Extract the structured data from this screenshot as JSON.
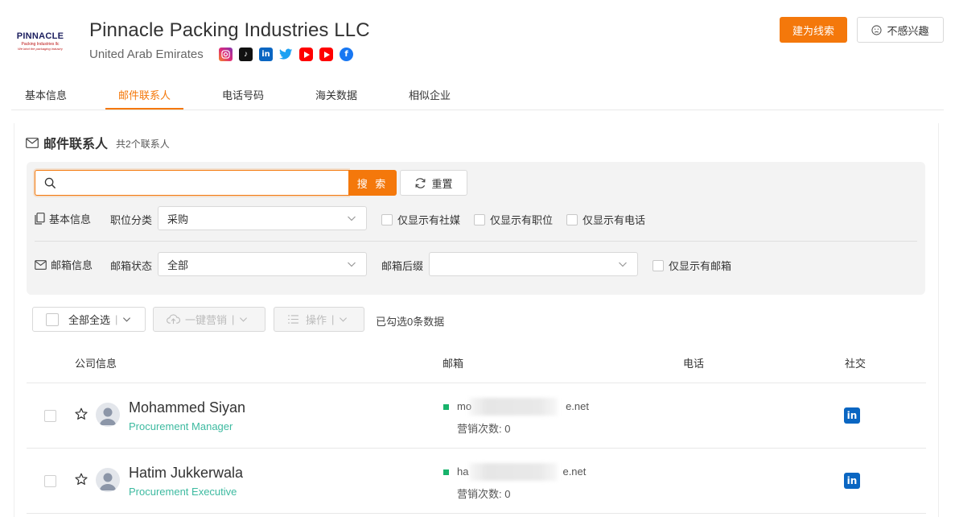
{
  "company": {
    "logo_text": "PINNACLE",
    "logo_sub": "Packing Industries llc",
    "logo_tagline": "We bind the packaging industry",
    "name": "Pinnacle Packing Industries LLC",
    "country": "United Arab Emirates",
    "socials": [
      {
        "icon": "instagram-icon",
        "color": "#e1306c"
      },
      {
        "icon": "tiktok-icon",
        "color": "#111111"
      },
      {
        "icon": "linkedin-icon",
        "color": "#0a66c2"
      },
      {
        "icon": "twitter-icon",
        "color": "#1da1f2"
      },
      {
        "icon": "youtube-icon",
        "color": "#ff0000"
      },
      {
        "icon": "youtube-icon",
        "color": "#ff0000"
      },
      {
        "icon": "facebook-icon",
        "color": "#1877f2"
      }
    ]
  },
  "actions": {
    "lead_label": "建为线索",
    "not_interested_label": "不感兴趣"
  },
  "tabs": [
    {
      "label": "基本信息"
    },
    {
      "label": "邮件联系人",
      "active": true
    },
    {
      "label": "电话号码"
    },
    {
      "label": "海关数据"
    },
    {
      "label": "相似企业"
    }
  ],
  "section": {
    "title": "邮件联系人",
    "count": "共2个联系人"
  },
  "filter": {
    "search_value": "",
    "search_label": "搜 索",
    "reset_label": "重置",
    "basic_info_label": "基本信息",
    "position_label": "职位分类",
    "position_value": "采购",
    "only_social": "仅显示有社媒",
    "only_position": "仅显示有职位",
    "only_phone": "仅显示有电话",
    "email_info_label": "邮箱信息",
    "email_status_label": "邮箱状态",
    "email_status_value": "全部",
    "email_suffix_label": "邮箱后缀",
    "email_suffix_value": "",
    "only_email": "仅显示有邮箱"
  },
  "toolbar": {
    "select_all": "全部全选",
    "one_click": "一键营销",
    "operations": "操作",
    "selected": "已勾选0条数据"
  },
  "table": {
    "headers": {
      "company": "公司信息",
      "email": "邮箱",
      "phone": "电话",
      "social": "社交"
    },
    "rows": [
      {
        "name": "Mohammed Siyan",
        "title": "Procurement Manager",
        "email_start": "mo",
        "email_end": "e.net",
        "marketing": "营销次数:  0",
        "status_color": "#18b36b"
      },
      {
        "name": "Hatim Jukkerwala",
        "title": "Procurement Executive",
        "email_start": "ha",
        "email_end": "e.net",
        "marketing": "营销次数:  0",
        "status_color": "#18b36b"
      }
    ]
  },
  "colors": {
    "accent": "#f4780b",
    "title_green": "#3dbaa0",
    "linkedin": "#0a66c2"
  }
}
